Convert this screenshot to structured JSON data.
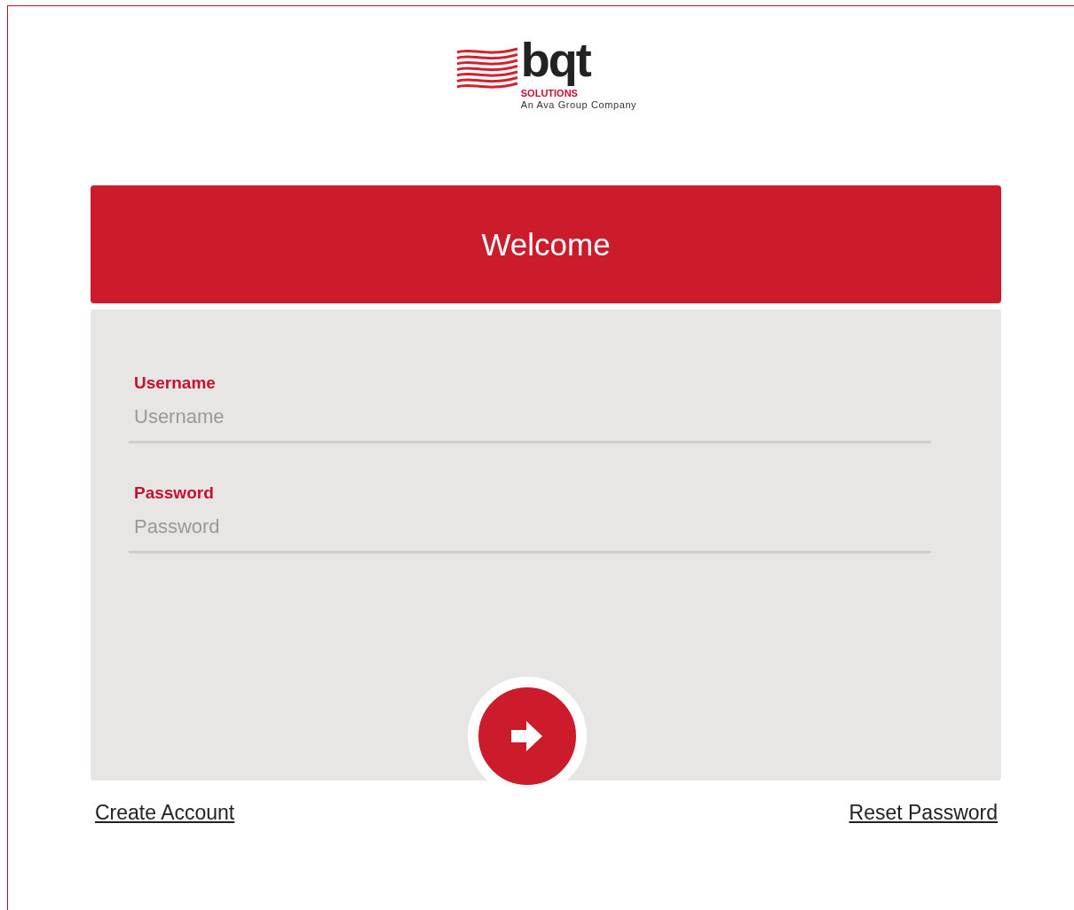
{
  "logo": {
    "wordmark": "bqt",
    "subtitle": "SOLUTIONS",
    "tagline": "An Ava Group Company"
  },
  "header": {
    "title": "Welcome"
  },
  "fields": [
    {
      "label": "Username",
      "placeholder": "Username"
    },
    {
      "label": "Password",
      "placeholder": "Password"
    }
  ],
  "links": [
    {
      "label": "Create Account"
    },
    {
      "label": "Reset Password"
    }
  ]
}
